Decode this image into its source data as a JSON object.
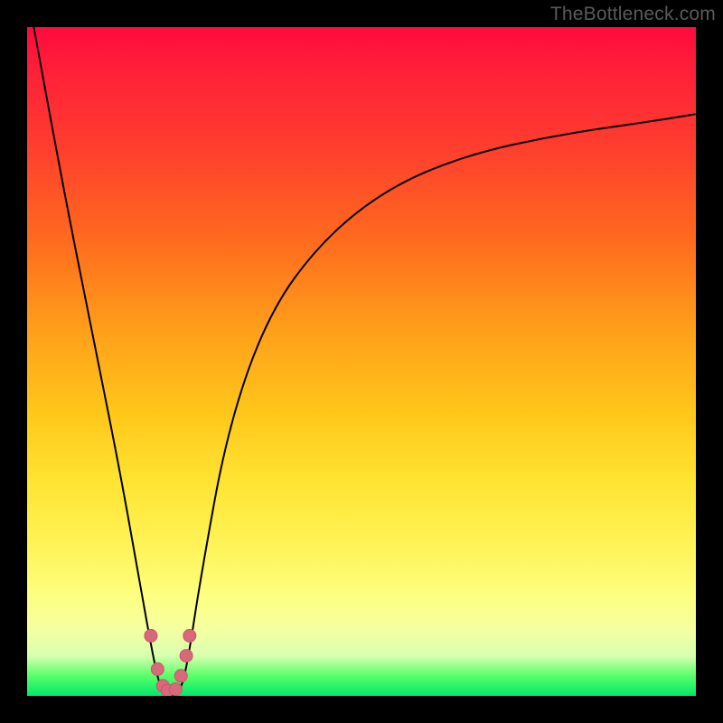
{
  "watermark": "TheBottleneck.com",
  "colors": {
    "frame": "#000000",
    "curve_stroke": "#000000",
    "marker_fill": "#d8697a",
    "marker_stroke": "#cc5566",
    "gradient_top": "#ff0a3e",
    "gradient_bottom": "#00e86a"
  },
  "chart_data": {
    "type": "line",
    "title": "",
    "xlabel": "",
    "ylabel": "",
    "xlim": [
      0,
      100
    ],
    "ylim": [
      0,
      100
    ],
    "legend_visible": false,
    "grid": false,
    "notes": "Single V-shaped curve on a vertical color gradient background (red at top → green at bottom). No axis ticks or labels shown; y increases downward visually but lower curve positions correspond to lower bottleneck values (green=good). Curve estimated from pixel positions.",
    "series": [
      {
        "name": "bottleneck-curve",
        "x": [
          1,
          5,
          10,
          14,
          17,
          19,
          20,
          21,
          22,
          23,
          24,
          26,
          30,
          36,
          44,
          54,
          66,
          80,
          94,
          100
        ],
        "y": [
          100,
          78,
          53,
          33,
          16,
          5,
          1,
          0,
          0,
          1,
          5,
          18,
          40,
          57,
          68,
          76,
          81,
          84,
          86,
          87
        ]
      }
    ],
    "markers": {
      "name": "highlighted-points",
      "x": [
        18.5,
        19.5,
        20.3,
        21.0,
        22.2,
        23.0,
        23.8,
        24.3
      ],
      "y": [
        9,
        4,
        1.5,
        0.8,
        1.0,
        3,
        6,
        9
      ],
      "radius": 7
    }
  }
}
